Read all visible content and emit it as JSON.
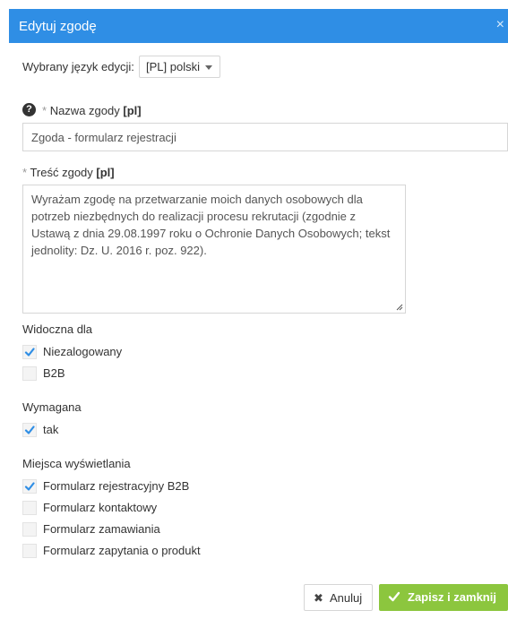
{
  "dialog": {
    "title": "Edytuj zgodę",
    "close_icon": "×"
  },
  "language": {
    "label": "Wybrany język edycji:",
    "selected": "[PL] polski"
  },
  "name_field": {
    "help_icon": "?",
    "required_mark": "*",
    "label": "Nazwa zgody",
    "lang_tag": "[pl]",
    "value": "Zgoda - formularz rejestracji"
  },
  "content_field": {
    "required_mark": "*",
    "label": "Treść zgody",
    "lang_tag": "[pl]",
    "value": "Wyrażam zgodę na przetwarzanie moich danych osobowych dla potrzeb niezbędnych do realizacji procesu rekrutacji (zgodnie z Ustawą z dnia 29.08.1997 roku o Ochronie Danych Osobowych; tekst jednolity: Dz. U. 2016 r. poz. 922)."
  },
  "visible_for": {
    "title": "Widoczna dla",
    "options": [
      {
        "label": "Niezalogowany",
        "checked": true
      },
      {
        "label": "B2B",
        "checked": false
      }
    ]
  },
  "required": {
    "title": "Wymagana",
    "options": [
      {
        "label": "tak",
        "checked": true
      }
    ]
  },
  "display_places": {
    "title": "Miejsca wyświetlania",
    "options": [
      {
        "label": "Formularz rejestracyjny B2B",
        "checked": true
      },
      {
        "label": "Formularz kontaktowy",
        "checked": false
      },
      {
        "label": "Formularz zamawiania",
        "checked": false
      },
      {
        "label": "Formularz zapytania o produkt",
        "checked": false
      }
    ]
  },
  "buttons": {
    "cancel": "Anuluj",
    "save": "Zapisz i zamknij"
  },
  "colors": {
    "header": "#2f8ee5",
    "save": "#8cc63e",
    "check": "#2f8ee5"
  }
}
